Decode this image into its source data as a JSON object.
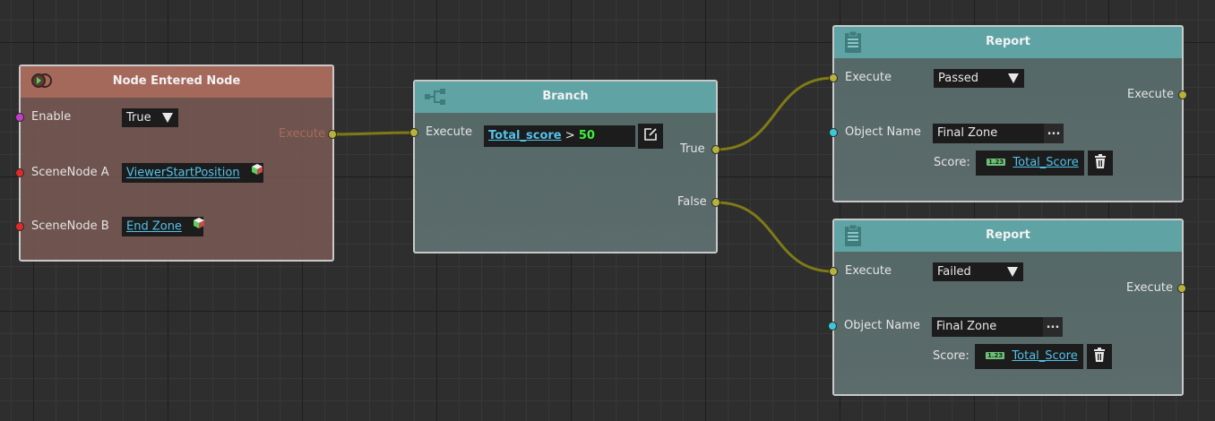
{
  "nodes": {
    "entered": {
      "title": "Node Entered Node",
      "enable_label": "Enable",
      "enable_value": "True",
      "scene_a_label": "SceneNode A",
      "scene_a_value": "ViewerStartPosition",
      "scene_b_label": "SceneNode B",
      "scene_b_value": "End Zone",
      "execute_out_label": "Execute"
    },
    "branch": {
      "title": "Branch",
      "execute_in_label": "Execute",
      "condition_var": "Total_score",
      "condition_op": ">",
      "condition_value": "50",
      "true_label": "True",
      "false_label": "False"
    },
    "report_passed": {
      "title": "Report",
      "execute_in_label": "Execute",
      "status_value": "Passed",
      "execute_out_label": "Execute",
      "object_name_label": "Object Name",
      "object_name_value": "Final Zone",
      "ellipsis": "...",
      "score_label": "Score:",
      "score_badge": "1.23",
      "score_value": "Total_Score"
    },
    "report_failed": {
      "title": "Report",
      "execute_in_label": "Execute",
      "status_value": "Failed",
      "execute_out_label": "Execute",
      "object_name_label": "Object Name",
      "object_name_value": "Final Zone",
      "ellipsis": "...",
      "score_label": "Score:",
      "score_badge": "1.23",
      "score_value": "Total_Score"
    }
  },
  "colors": {
    "wire": "#7f7a16",
    "entered_header": "#a5695c",
    "teal_header": "#5fa3a4",
    "link": "#52c2ea",
    "number": "#3df03d"
  }
}
